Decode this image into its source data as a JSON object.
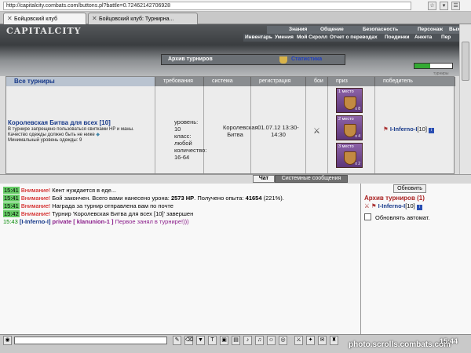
{
  "browser": {
    "url": "http://capitalcity.combats.com/buttons.pl?battle=0.72462142706928",
    "tabs": [
      {
        "label": "Бойцовский клуб"
      },
      {
        "label": "Бойцовский клуб: Турнирна..."
      }
    ]
  },
  "header": {
    "logo": "CAPITALCITY",
    "menu_top": [
      "Знания",
      "Общение",
      "Безопасность",
      "Персонаж",
      "Вых"
    ],
    "menu_bottom": [
      "Инвентарь",
      "Умения",
      "Мой Скролл",
      "Отчет о переводах",
      "Поединки",
      "Анкета",
      "Пер"
    ],
    "title": "Архив турниров",
    "stats_link": "Статистика",
    "small_note": "турниры"
  },
  "table": {
    "headers": [
      "Все турниры",
      "требования",
      "система",
      "регистрация",
      "бои",
      "приз",
      "победитель"
    ],
    "row": {
      "name": "Королевская Битва для всех [10]",
      "desc": "В турнире запрещено пользоваться свитками HP и маны. Качество одежды должно быть не ниже",
      "desc2": "Минимальный уровень одежды: 9",
      "req": [
        "уровень: 10",
        "класс: любой",
        "количество: 16-64"
      ],
      "system": "Королевская Битва",
      "registration": "01.07.12 13:30-14:30",
      "prizes": [
        {
          "place": "1 место",
          "count": "x 8"
        },
        {
          "place": "2 место",
          "count": "x 4"
        },
        {
          "place": "3 место",
          "count": "x 2"
        }
      ],
      "winner": "I-Inferno-I",
      "winner_level": "[10]"
    }
  },
  "chat": {
    "tab_chat": "Чат",
    "tab_system": "Системные сообщения",
    "lines": [
      {
        "time": "15:41",
        "label": "Внимание!",
        "text": "Кент нуждается в еде..."
      },
      {
        "time": "15:41",
        "label": "Внимание!",
        "text": "Бой закончен. Всего вами нанесено урона:",
        "dmg": "2573 HP",
        "text2": ". Получено опыта:",
        "exp": "41654",
        "text3": "(221%)."
      },
      {
        "time": "15:41",
        "label": "Внимание!",
        "text": "Награда за турнир отправлена вам по почте"
      },
      {
        "time": "15:42",
        "label": "Внимание!",
        "text": "Турнир 'Королевская Битва для всех [10]' завершен"
      },
      {
        "time": "15:43",
        "from": "[I-Inferno-I]",
        "private": "private [ klanunion-1 ]",
        "msg": "Первое занял в турнире!)))"
      }
    ],
    "side": {
      "refresh": "Обновить",
      "archive": "Архив турниров (1)",
      "player": "I-Inferno-I",
      "player_level": "[10]",
      "auto": "Обновлять автомат."
    }
  },
  "footer": {
    "watermark": "photo.scrolls.combats.com",
    "clock": "15:44"
  },
  "colors": {
    "link_blue": "#183a8a",
    "warning_red": "#cc0000",
    "time_green": "#66cc66",
    "private_purple": "#8a1c8a"
  }
}
